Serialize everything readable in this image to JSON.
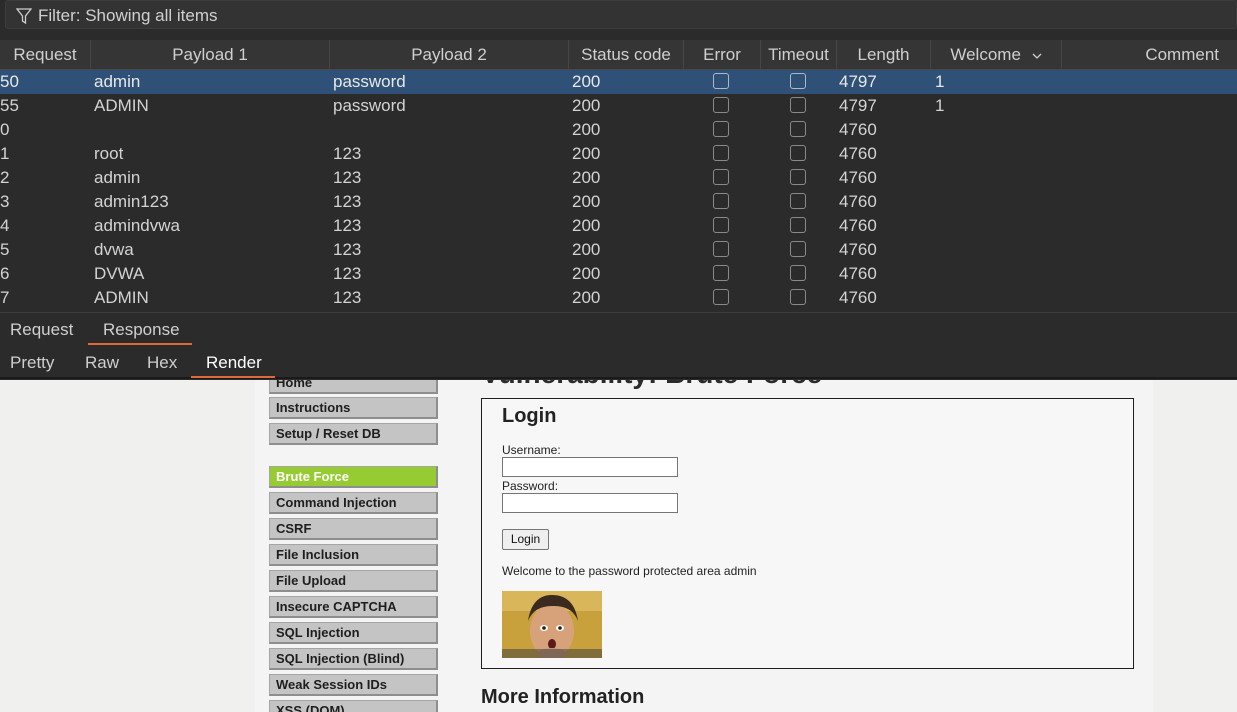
{
  "filter": {
    "text": "Filter: Showing all items"
  },
  "columns": {
    "request": "Request",
    "payload1": "Payload 1",
    "payload2": "Payload 2",
    "status": "Status code",
    "error": "Error",
    "timeout": "Timeout",
    "length": "Length",
    "welcome": "Welcome",
    "comment": "Comment"
  },
  "rows": [
    {
      "request": "50",
      "payload1": "admin",
      "payload2": "password",
      "status": "200",
      "length": "4797",
      "welcome": "1",
      "selected": true
    },
    {
      "request": "55",
      "payload1": "ADMIN",
      "payload2": "password",
      "status": "200",
      "length": "4797",
      "welcome": "1"
    },
    {
      "request": "0",
      "payload1": "",
      "payload2": "",
      "status": "200",
      "length": "4760",
      "welcome": ""
    },
    {
      "request": "1",
      "payload1": "root",
      "payload2": "123",
      "status": "200",
      "length": "4760",
      "welcome": ""
    },
    {
      "request": "2",
      "payload1": "admin",
      "payload2": "123",
      "status": "200",
      "length": "4760",
      "welcome": ""
    },
    {
      "request": "3",
      "payload1": "admin123",
      "payload2": "123",
      "status": "200",
      "length": "4760",
      "welcome": ""
    },
    {
      "request": "4",
      "payload1": "admindvwa",
      "payload2": "123",
      "status": "200",
      "length": "4760",
      "welcome": ""
    },
    {
      "request": "5",
      "payload1": "dvwa",
      "payload2": "123",
      "status": "200",
      "length": "4760",
      "welcome": ""
    },
    {
      "request": "6",
      "payload1": "DVWA",
      "payload2": "123",
      "status": "200",
      "length": "4760",
      "welcome": ""
    },
    {
      "request": "7",
      "payload1": "ADMIN",
      "payload2": "123",
      "status": "200",
      "length": "4760",
      "welcome": ""
    }
  ],
  "tabs_main": {
    "request": "Request",
    "response": "Response",
    "active": "Response"
  },
  "tabs_view": {
    "pretty": "Pretty",
    "raw": "Raw",
    "hex": "Hex",
    "render": "Render",
    "active": "Render"
  },
  "dvwa": {
    "page_heading": "Vulnerability: Brute Force",
    "nav": {
      "home": "Home",
      "instructions": "Instructions",
      "setup": "Setup / Reset DB",
      "brute_force": "Brute Force",
      "command_injection": "Command Injection",
      "csrf": "CSRF",
      "file_inclusion": "File Inclusion",
      "file_upload": "File Upload",
      "insecure_captcha": "Insecure CAPTCHA",
      "sql_injection": "SQL Injection",
      "sql_injection_blind": "SQL Injection (Blind)",
      "weak_session": "Weak Session IDs",
      "xss_dom": "XSS (DOM)"
    },
    "login": {
      "title": "Login",
      "username_label": "Username:",
      "password_label": "Password:",
      "button": "Login",
      "welcome": "Welcome to the password protected area admin"
    },
    "more_info": "More Information"
  },
  "colors": {
    "selected_row": "#2f5178",
    "tab_accent": "#e0693a",
    "active_nav": "#96cc32"
  },
  "icons": {
    "filter": "filter-funnel-icon",
    "sort": "chevron-down-icon"
  }
}
